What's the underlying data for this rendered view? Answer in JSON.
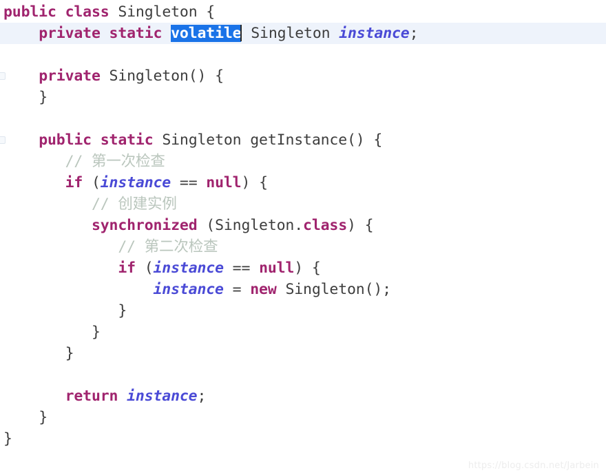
{
  "editor": {
    "language": "java",
    "colors": {
      "background": "#ffffff",
      "keyword": "#a0246e",
      "type": "#3d3d3d",
      "field": "#4a4ad6",
      "comment": "#bac6bd",
      "selection_background": "#1a73e8",
      "selection_foreground": "#ffffff",
      "current_line": "#eef3fb",
      "watermark": "#ededed"
    },
    "selection": {
      "text": "volatile",
      "line": 2,
      "caret_visible": true
    },
    "current_line_number": 2,
    "gutter_markers": [
      {
        "line": 4
      },
      {
        "line": 7
      }
    ]
  },
  "watermark": {
    "text": "https://blog.csdn.net/Jarbein"
  },
  "lines": [
    {
      "n": 1,
      "indent": 0,
      "tokens": [
        {
          "t": "kw",
          "v": "public"
        },
        {
          "t": "pun",
          "v": " "
        },
        {
          "t": "kw",
          "v": "class"
        },
        {
          "t": "pun",
          "v": " "
        },
        {
          "t": "typ",
          "v": "Singleton"
        },
        {
          "t": "pun",
          "v": " {"
        }
      ]
    },
    {
      "n": 2,
      "indent": 4,
      "highlighted": true,
      "tokens": [
        {
          "t": "kw",
          "v": "private"
        },
        {
          "t": "pun",
          "v": " "
        },
        {
          "t": "kw",
          "v": "static"
        },
        {
          "t": "pun",
          "v": " "
        },
        {
          "t": "sel",
          "v": "volatile"
        },
        {
          "t": "caret",
          "v": ""
        },
        {
          "t": "pun",
          "v": " "
        },
        {
          "t": "typ",
          "v": "Singleton"
        },
        {
          "t": "pun",
          "v": " "
        },
        {
          "t": "fld",
          "v": "instance"
        },
        {
          "t": "pun",
          "v": ";"
        }
      ]
    },
    {
      "n": 3,
      "indent": 0,
      "tokens": []
    },
    {
      "n": 4,
      "indent": 4,
      "tokens": [
        {
          "t": "kw",
          "v": "private"
        },
        {
          "t": "pun",
          "v": " "
        },
        {
          "t": "typ",
          "v": "Singleton"
        },
        {
          "t": "pun",
          "v": "() {"
        }
      ]
    },
    {
      "n": 5,
      "indent": 4,
      "tokens": [
        {
          "t": "pun",
          "v": "}"
        }
      ]
    },
    {
      "n": 6,
      "indent": 0,
      "tokens": []
    },
    {
      "n": 7,
      "indent": 4,
      "tokens": [
        {
          "t": "kw",
          "v": "public"
        },
        {
          "t": "pun",
          "v": " "
        },
        {
          "t": "kw",
          "v": "static"
        },
        {
          "t": "pun",
          "v": " "
        },
        {
          "t": "typ",
          "v": "Singleton"
        },
        {
          "t": "pun",
          "v": " "
        },
        {
          "t": "typ",
          "v": "getInstance"
        },
        {
          "t": "pun",
          "v": "() {"
        }
      ]
    },
    {
      "n": 8,
      "indent": 7,
      "tokens": [
        {
          "t": "cmt",
          "v": "// 第一次检查"
        }
      ]
    },
    {
      "n": 9,
      "indent": 7,
      "tokens": [
        {
          "t": "kw",
          "v": "if"
        },
        {
          "t": "pun",
          "v": " ("
        },
        {
          "t": "fld",
          "v": "instance"
        },
        {
          "t": "pun",
          "v": " == "
        },
        {
          "t": "kw",
          "v": "null"
        },
        {
          "t": "pun",
          "v": ") {"
        }
      ]
    },
    {
      "n": 10,
      "indent": 10,
      "tokens": [
        {
          "t": "cmt",
          "v": "// 创建实例"
        }
      ]
    },
    {
      "n": 11,
      "indent": 10,
      "tokens": [
        {
          "t": "kw",
          "v": "synchronized"
        },
        {
          "t": "pun",
          "v": " ("
        },
        {
          "t": "typ",
          "v": "Singleton"
        },
        {
          "t": "pun",
          "v": "."
        },
        {
          "t": "kw",
          "v": "class"
        },
        {
          "t": "pun",
          "v": ") {"
        }
      ]
    },
    {
      "n": 12,
      "indent": 13,
      "tokens": [
        {
          "t": "cmt",
          "v": "// 第二次检查"
        }
      ]
    },
    {
      "n": 13,
      "indent": 13,
      "tokens": [
        {
          "t": "kw",
          "v": "if"
        },
        {
          "t": "pun",
          "v": " ("
        },
        {
          "t": "fld",
          "v": "instance"
        },
        {
          "t": "pun",
          "v": " == "
        },
        {
          "t": "kw",
          "v": "null"
        },
        {
          "t": "pun",
          "v": ") {"
        }
      ]
    },
    {
      "n": 14,
      "indent": 17,
      "tokens": [
        {
          "t": "fld",
          "v": "instance"
        },
        {
          "t": "pun",
          "v": " = "
        },
        {
          "t": "kw",
          "v": "new"
        },
        {
          "t": "pun",
          "v": " "
        },
        {
          "t": "typ",
          "v": "Singleton"
        },
        {
          "t": "pun",
          "v": "();"
        }
      ]
    },
    {
      "n": 15,
      "indent": 13,
      "tokens": [
        {
          "t": "pun",
          "v": "}"
        }
      ]
    },
    {
      "n": 16,
      "indent": 10,
      "tokens": [
        {
          "t": "pun",
          "v": "}"
        }
      ]
    },
    {
      "n": 17,
      "indent": 7,
      "tokens": [
        {
          "t": "pun",
          "v": "}"
        }
      ]
    },
    {
      "n": 18,
      "indent": 0,
      "tokens": []
    },
    {
      "n": 19,
      "indent": 7,
      "tokens": [
        {
          "t": "kw",
          "v": "return"
        },
        {
          "t": "pun",
          "v": " "
        },
        {
          "t": "fld",
          "v": "instance"
        },
        {
          "t": "pun",
          "v": ";"
        }
      ]
    },
    {
      "n": 20,
      "indent": 4,
      "tokens": [
        {
          "t": "pun",
          "v": "}"
        }
      ]
    },
    {
      "n": 21,
      "indent": 0,
      "tokens": [
        {
          "t": "pun",
          "v": "}"
        }
      ]
    }
  ]
}
